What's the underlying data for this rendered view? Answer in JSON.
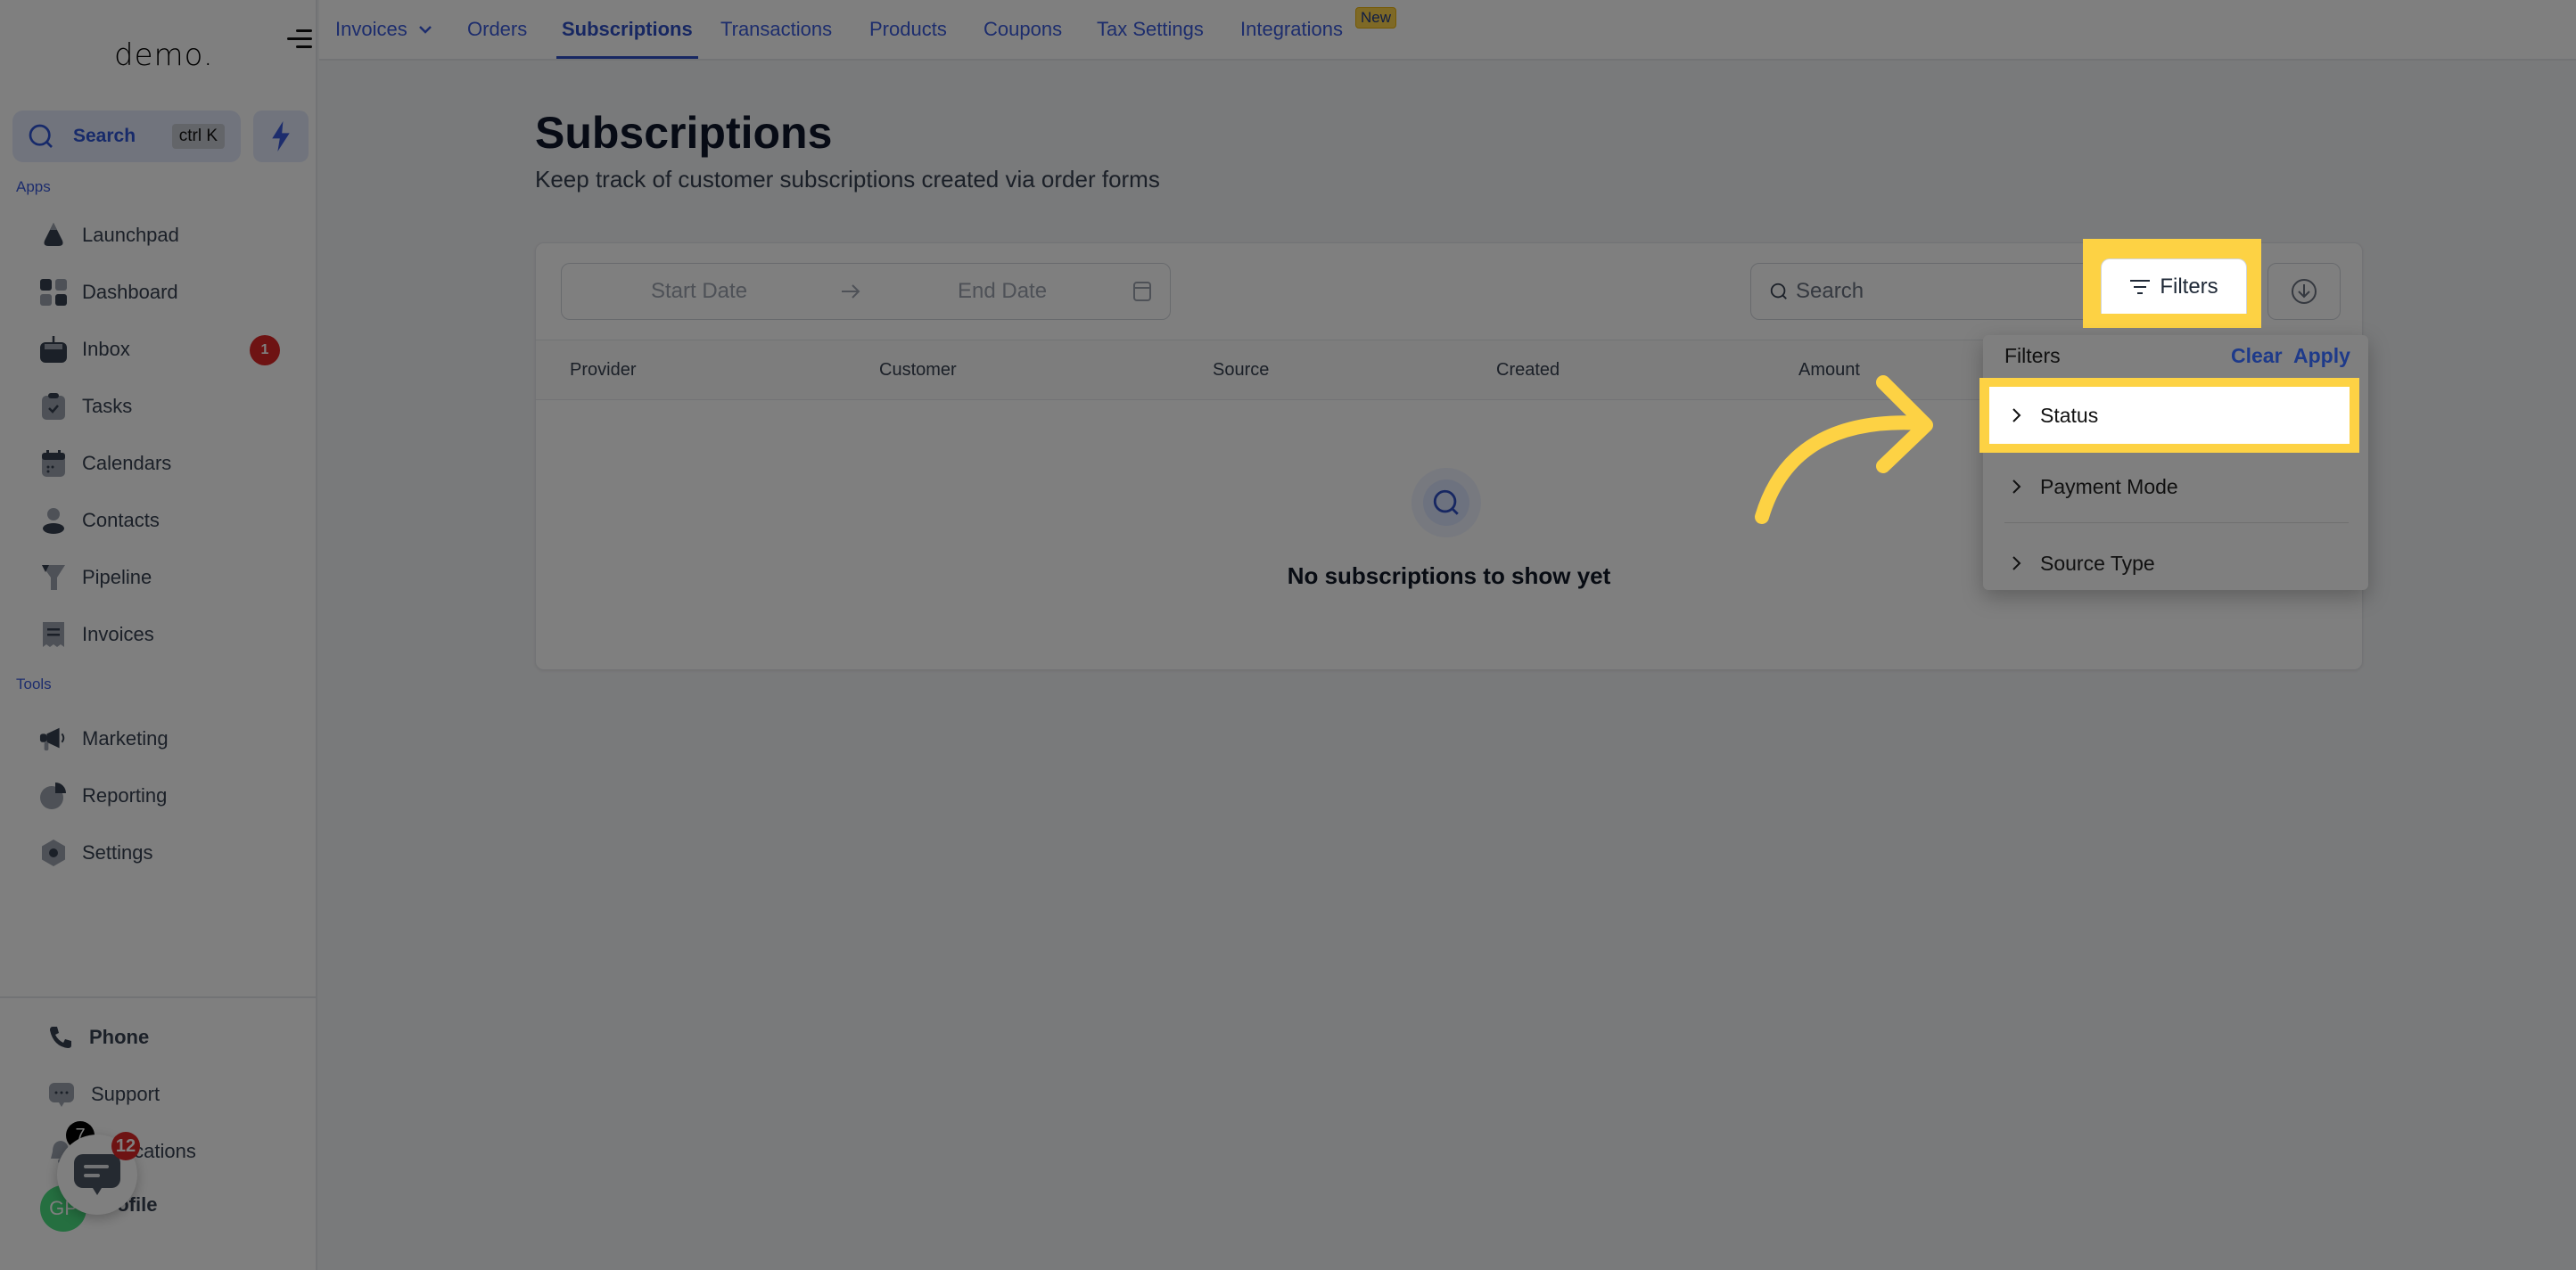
{
  "sidebar": {
    "logo": "demo.",
    "search": {
      "label": "Search",
      "shortcut": "ctrl K"
    },
    "apps_label": "Apps",
    "tools_label": "Tools",
    "apps": [
      {
        "label": "Launchpad",
        "icon": "rocket-icon"
      },
      {
        "label": "Dashboard",
        "icon": "grid-icon"
      },
      {
        "label": "Inbox",
        "icon": "inbox-icon",
        "badge": "1"
      },
      {
        "label": "Tasks",
        "icon": "clipboard-check-icon"
      },
      {
        "label": "Calendars",
        "icon": "calendar-icon"
      },
      {
        "label": "Contacts",
        "icon": "person-icon"
      },
      {
        "label": "Pipeline",
        "icon": "funnel-icon"
      },
      {
        "label": "Invoices",
        "icon": "receipt-icon"
      }
    ],
    "tools": [
      {
        "label": "Marketing",
        "icon": "megaphone-icon"
      },
      {
        "label": "Reporting",
        "icon": "pie-chart-icon"
      },
      {
        "label": "Settings",
        "icon": "gear-icon"
      }
    ],
    "bottom": [
      {
        "label": "Phone",
        "icon": "phone-icon"
      },
      {
        "label": "Support",
        "icon": "chat-bubble-icon"
      },
      {
        "label": "Notifications",
        "icon": "bell-icon",
        "badge": "7"
      },
      {
        "label": "Profile",
        "avatar": "GP"
      }
    ],
    "chat_widget_badge": "12"
  },
  "topnav": {
    "tabs": [
      {
        "label": "Invoices",
        "has_dropdown": true
      },
      {
        "label": "Orders"
      },
      {
        "label": "Subscriptions",
        "active": true
      },
      {
        "label": "Transactions"
      },
      {
        "label": "Products"
      },
      {
        "label": "Coupons"
      },
      {
        "label": "Tax Settings"
      },
      {
        "label": "Integrations",
        "badge": "New"
      }
    ]
  },
  "main": {
    "title": "Subscriptions",
    "subtitle": "Keep track of customer subscriptions created via order forms",
    "date_range": {
      "start_placeholder": "Start Date",
      "end_placeholder": "End Date"
    },
    "search_placeholder": "Search",
    "filters_button": "Filters",
    "table": {
      "columns": [
        "Provider",
        "Customer",
        "Source",
        "Created",
        "Amount"
      ],
      "rows": [],
      "empty_message": "No subscriptions to show yet"
    }
  },
  "filters_dropdown": {
    "title": "Filters",
    "clear": "Clear",
    "apply": "Apply",
    "items": [
      "Status",
      "Payment Mode",
      "Source Type"
    ],
    "highlighted": "Status"
  },
  "colors": {
    "accent": "#2f4fc4",
    "highlight": "#fdd244",
    "badge_red": "#dc2626"
  }
}
